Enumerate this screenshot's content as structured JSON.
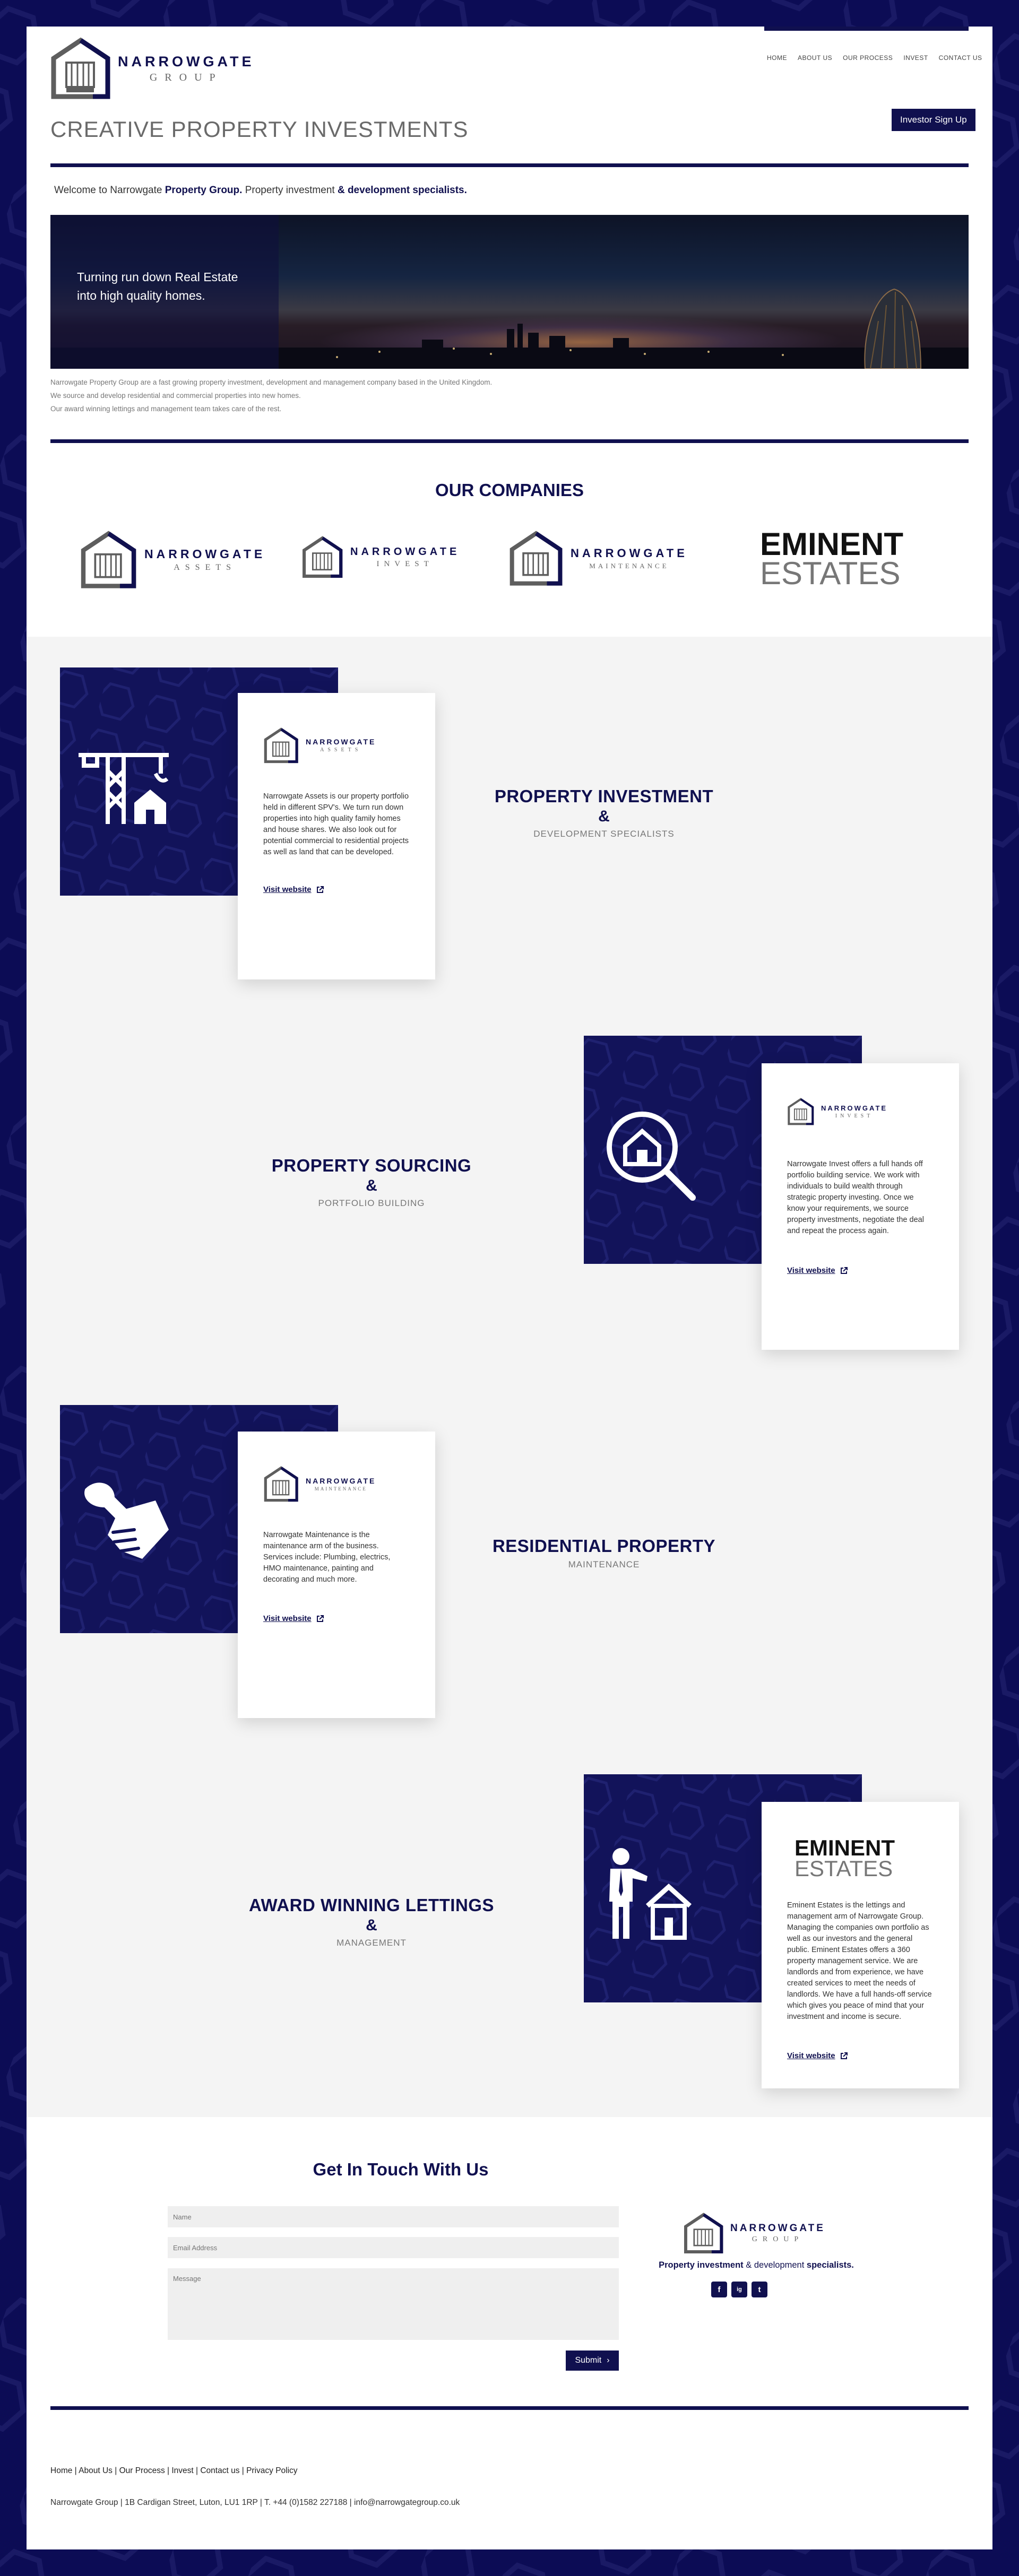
{
  "logo": {
    "line1": "NARROWGATE",
    "line2": "GROUP"
  },
  "nav": [
    "HOME",
    "ABOUT US",
    "OUR PROCESS",
    "INVEST",
    "CONTACT US"
  ],
  "tagline": "CREATIVE PROPERTY INVESTMENTS",
  "investor_button": "Investor Sign Up",
  "welcome": {
    "p1": "Welcome to Narrowgate ",
    "b1": "Property Group.",
    "p2": " Property investment ",
    "b2": "& development specialists."
  },
  "hero": {
    "text": "Turning run down Real Estate into high quality homes."
  },
  "intro": [
    "Narrowgate Property Group are a fast growing property investment, development and management company based in the United Kingdom.",
    "We source and develop residential and commercial properties into new homes.",
    "Our award winning lettings and management team takes care of the rest."
  ],
  "companies": {
    "heading": "OUR COMPANIES",
    "logos": [
      {
        "line1": "NARROWGATE",
        "line2": "ASSETS"
      },
      {
        "line1": "NARROWGATE",
        "line2": "INVEST"
      },
      {
        "line1": "NARROWGATE",
        "line2": "MAINTENANCE"
      },
      {
        "line1": "EMINENT",
        "line2": "ESTATES"
      }
    ]
  },
  "sections": [
    {
      "icon": "crane-icon",
      "logo1": "NARROWGATE",
      "logo2": "ASSETS",
      "desc": "Narrowgate Assets is our property portfolio held in different SPV's. We turn run down properties into high quality family homes and house shares. We also look out for potential commercial to residential projects as well as land that can be developed.",
      "link": "Visit website",
      "title": "PROPERTY INVESTMENT",
      "amp": "&",
      "sub": "DEVELOPMENT SPECIALISTS"
    },
    {
      "icon": "house-search-icon",
      "logo1": "NARROWGATE",
      "logo2": "INVEST",
      "desc": "Narrowgate Invest offers a full hands off portfolio building service. We work with individuals to build wealth through strategic property investing. Once we know your requirements, we source property investments, negotiate the deal and repeat the process again.",
      "link": "Visit website",
      "title": "PROPERTY SOURCING",
      "amp": "&",
      "sub": "PORTFOLIO BUILDING"
    },
    {
      "icon": "wrench-hand-icon",
      "logo1": "NARROWGATE",
      "logo2": "MAINTENANCE",
      "desc": "Narrowgate Maintenance is the maintenance arm of the business. Services include: Plumbing, electrics, HMO maintenance, painting and decorating and much more.",
      "link": "Visit website",
      "title": "RESIDENTIAL PROPERTY",
      "amp": "",
      "sub": "MAINTENANCE"
    },
    {
      "icon": "agent-house-icon",
      "logo1": "EMINENT",
      "logo2": "ESTATES",
      "desc": "Eminent Estates is the lettings and management arm of Narrowgate Group. Managing the companies own portfolio as well as our investors and the general public. Eminent Estates offers a 360 property management service. We are landlords and from experience, we have created services to meet the needs of landlords. We have a full hands-off service which gives you peace of mind that your investment and income is secure.",
      "link": "Visit website",
      "title": "AWARD WINNING LETTINGS",
      "amp": "&",
      "sub": "MANAGEMENT"
    }
  ],
  "contact": {
    "heading": "Get In Touch With Us",
    "name_placeholder": "Name",
    "email_placeholder": "Email Address",
    "message_placeholder": "Message",
    "submit": "Submit",
    "tag_p1": "Property investment ",
    "tag_b1": "& development ",
    "tag_p2": "specialists."
  },
  "socials": [
    "f",
    "ig",
    "t"
  ],
  "footer": {
    "links": [
      "Home",
      "About Us",
      "Our Process",
      "Invest",
      "Contact us",
      "Privacy Policy"
    ],
    "address": "Narrowgate Group | 1B Cardigan Street, Luton, LU1 1RP | T. +44 (0)1582 227188 | info@narrowgategroup.co.uk"
  },
  "colors": {
    "brand": "#10104f",
    "grey_bg": "#f4f4f4"
  }
}
